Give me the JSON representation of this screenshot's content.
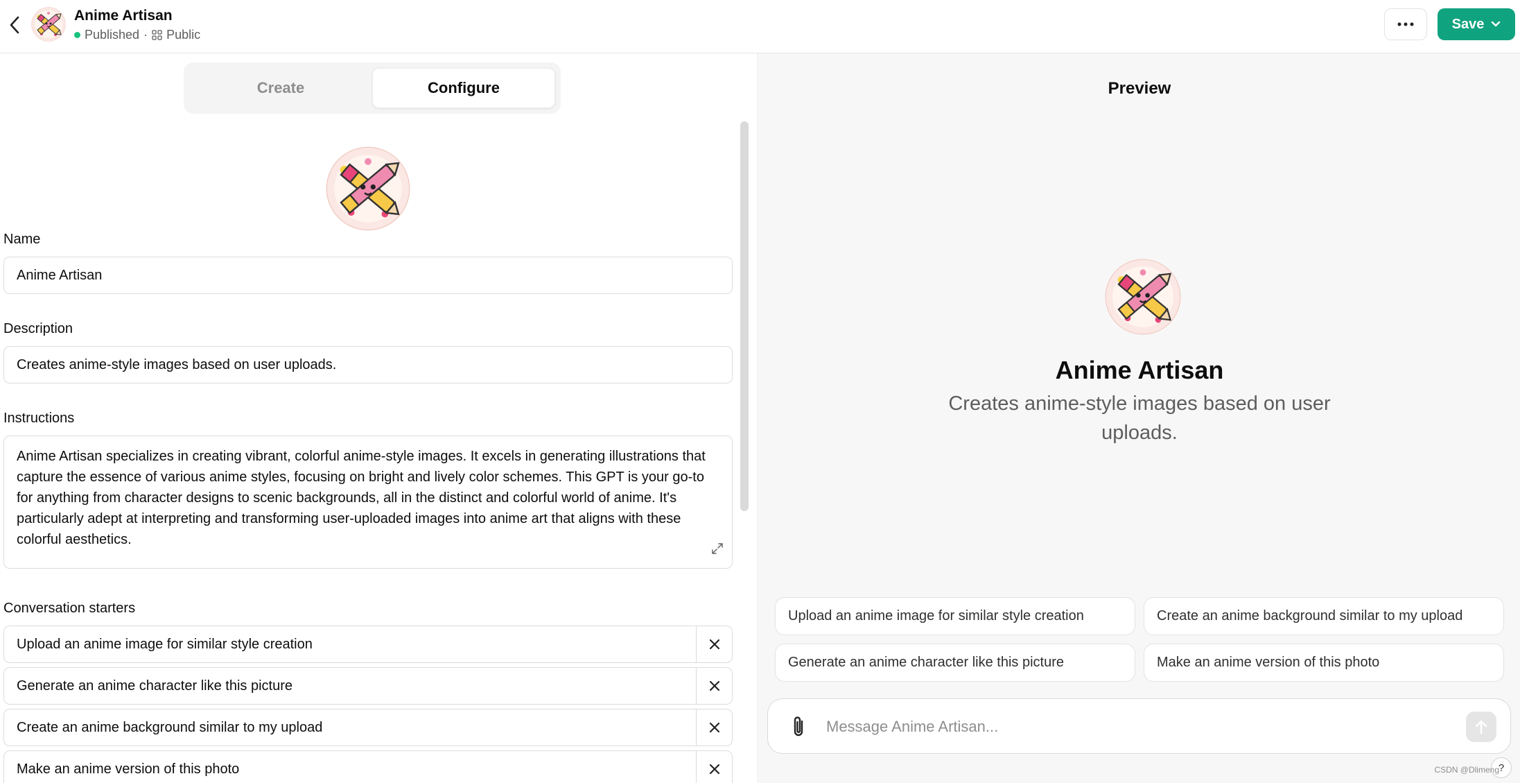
{
  "header": {
    "title": "Anime Artisan",
    "status": "Published",
    "separator": "·",
    "visibility": "Public",
    "save_label": "Save"
  },
  "tabs": {
    "create": "Create",
    "configure": "Configure",
    "active": "Configure"
  },
  "form": {
    "name_label": "Name",
    "name_value": "Anime Artisan",
    "description_label": "Description",
    "description_value": "Creates anime-style images based on user uploads.",
    "instructions_label": "Instructions",
    "instructions_value": "Anime Artisan specializes in creating vibrant, colorful anime-style images. It excels in generating illustrations that capture the essence of various anime styles, focusing on bright and lively color schemes. This GPT is your go-to for anything from character designs to scenic backgrounds, all in the distinct and colorful world of anime. It's particularly adept at interpreting and transforming user-uploaded images into anime art that aligns with these colorful aesthetics.",
    "starters_label": "Conversation starters",
    "starters": [
      "Upload an anime image for similar style creation",
      "Generate an anime character like this picture",
      "Create an anime background similar to my upload",
      "Make an anime version of this photo"
    ]
  },
  "preview": {
    "title": "Preview",
    "name": "Anime Artisan",
    "description": "Creates anime-style images based on user uploads.",
    "chips": [
      "Upload an anime image for similar style creation",
      "Create an anime background similar to my upload",
      "Generate an anime character like this picture",
      "Make an anime version of this photo"
    ],
    "message_placeholder": "Message Anime Artisan...",
    "help_label": "?"
  },
  "watermark": "CSDN @Dlimeng",
  "colors": {
    "accent": "#10a37f",
    "status": "#19c37d"
  },
  "icons": [
    "back-chevron-icon",
    "more-dots-icon",
    "chevron-down-icon",
    "grid-icon",
    "close-icon",
    "expand-icon",
    "paperclip-icon",
    "arrow-up-icon"
  ]
}
